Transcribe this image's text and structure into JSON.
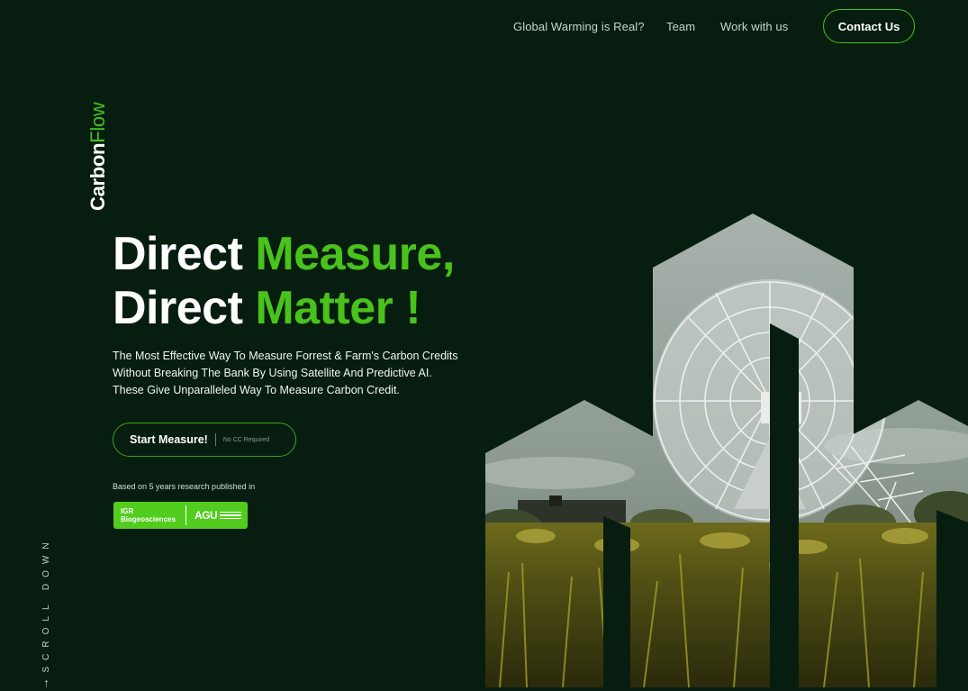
{
  "nav": {
    "links": [
      "Global Warming is Real?",
      "Team",
      "Work with us"
    ],
    "contact_label": "Contact Us"
  },
  "brand": {
    "part1": "Carbon",
    "part2": "Flow",
    "icon": "carbonflow-logo-icon"
  },
  "hero": {
    "line1_white": "Direct ",
    "line1_green": "Measure,",
    "line2_white": "Direct ",
    "line2_green": "Matter !",
    "description_lines": [
      "The Most Effective Way To Measure Forrest & Farm's Carbon Credits",
      "Without Breaking The Bank By Using Satellite And Predictive AI.",
      "These Give Unparalleled Way To Measure Carbon Credit."
    ],
    "cta_label": "Start Measure!",
    "cta_note": "No CC Required",
    "research_text": "Based on 5 years research published in",
    "badge": {
      "igr_line1": "IGR",
      "igr_line2": "Biogeosciences",
      "agu": "AGU"
    }
  },
  "scroll": {
    "label": "SCROLL DOWN",
    "arrow": "↓"
  },
  "colors": {
    "background": "#071d10",
    "accent": "#49c21b",
    "badge": "#52cc1e"
  }
}
